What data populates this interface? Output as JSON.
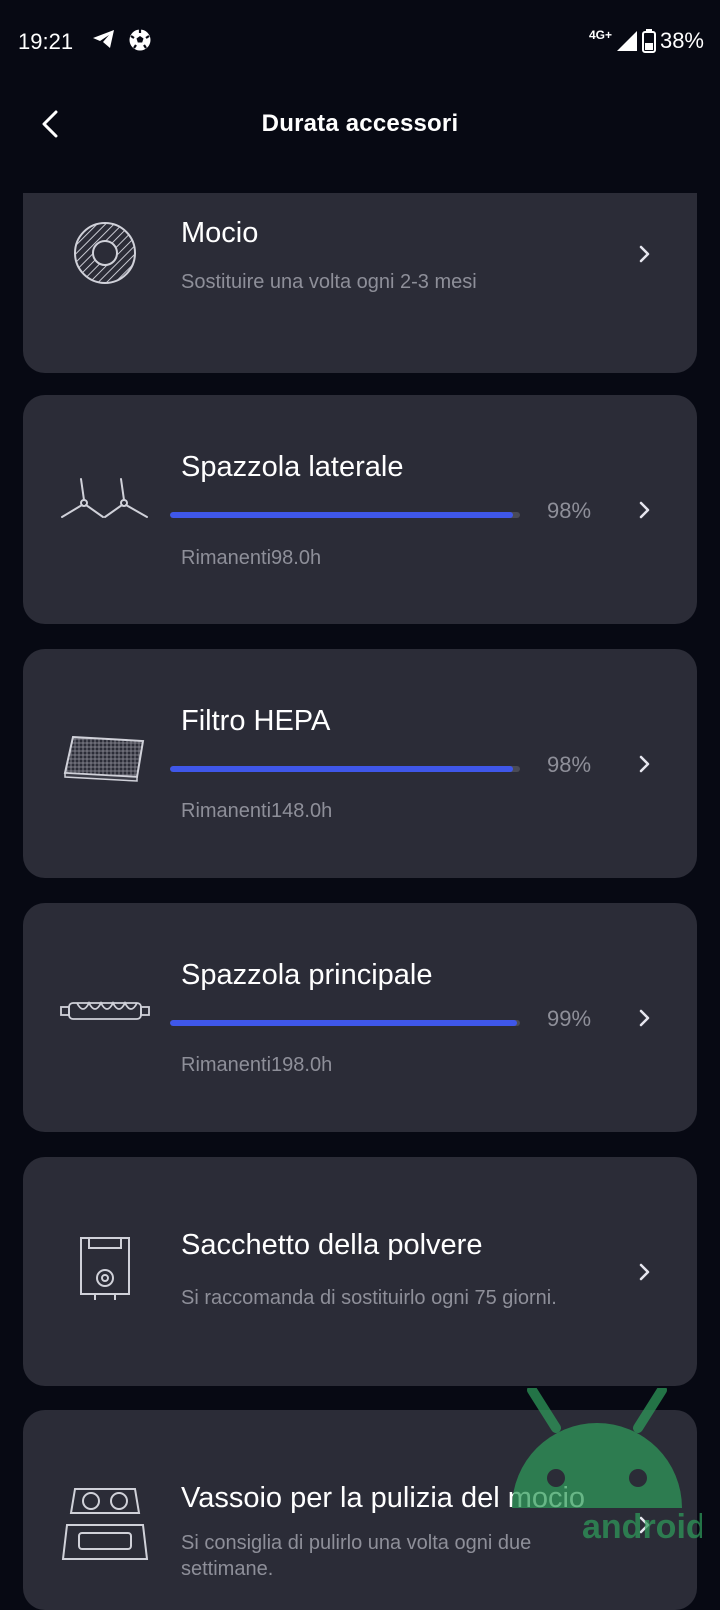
{
  "status_bar": {
    "time": "19:21",
    "network": "4G+",
    "battery": "38%"
  },
  "header": {
    "title": "Durata accessori"
  },
  "accessories": [
    {
      "name": "Mocio",
      "subtitle": "Sostituire una volta ogni 2-3 mesi",
      "icon": "mop-icon"
    },
    {
      "name": "Spazzola laterale",
      "percent_label": "98%",
      "percent": 98,
      "remaining": "Rimanenti98.0h",
      "icon": "side-brush-icon"
    },
    {
      "name": "Filtro HEPA",
      "percent_label": "98%",
      "percent": 98,
      "remaining": "Rimanenti148.0h",
      "icon": "hepa-filter-icon"
    },
    {
      "name": "Spazzola principale",
      "percent_label": "99%",
      "percent": 99,
      "remaining": "Rimanenti198.0h",
      "icon": "main-brush-icon"
    },
    {
      "name": "Sacchetto della polvere",
      "subtitle": "Si raccomanda di sostituirlo ogni 75 giorni.",
      "icon": "dust-bag-icon"
    },
    {
      "name": "Vassoio per la pulizia del mocio",
      "subtitle": "Si consiglia di pulirlo una volta ogni due settimane.",
      "icon": "mop-tray-icon"
    }
  ],
  "watermark": {
    "text": "android"
  },
  "colors": {
    "background": "#070913",
    "card": "#2b2c37",
    "progress": "#3f57e9",
    "muted_text": "#8e8f99"
  }
}
